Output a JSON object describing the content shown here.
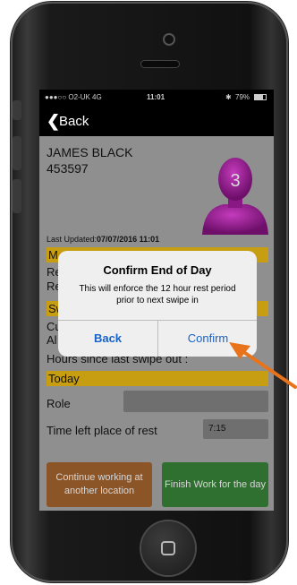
{
  "status_bar": {
    "carrier": "●●●○○ O2-UK  4G",
    "time": "11:01",
    "battery": "79%",
    "battery_level": 0.79,
    "bluetooth_icon": "bluetooth-icon"
  },
  "nav": {
    "back_label": "Back",
    "back_icon": "chevron-left-icon"
  },
  "worker": {
    "name": "JAMES BLACK",
    "id": "453597",
    "avatar_badge": "3",
    "avatar_color": "#a01c9a"
  },
  "last_updated": {
    "label": "Last Updated:",
    "value": "07/07/2016 11:01"
  },
  "hidden_rows": {
    "bar1": "M",
    "row1a": "Re",
    "row1b": "Re",
    "bar2": "Sw",
    "row2a": "Cu",
    "row2b": "Al"
  },
  "hours_label": "Hours since last swipe out :",
  "today_label": "Today",
  "role_label": "Role",
  "time_left": {
    "label": "Time left place of rest",
    "value": "7:15"
  },
  "buttons": {
    "continue": "Continue working at another location",
    "finish": "Finish Work for the day"
  },
  "alert": {
    "title": "Confirm End of Day",
    "message": "This will enforce the 12 hour rest period prior to next swipe in",
    "back": "Back",
    "confirm": "Confirm"
  },
  "colors": {
    "accent_bar": "#c79d12",
    "alert_link": "#1762c9",
    "annotation_arrow": "#e8731a"
  }
}
